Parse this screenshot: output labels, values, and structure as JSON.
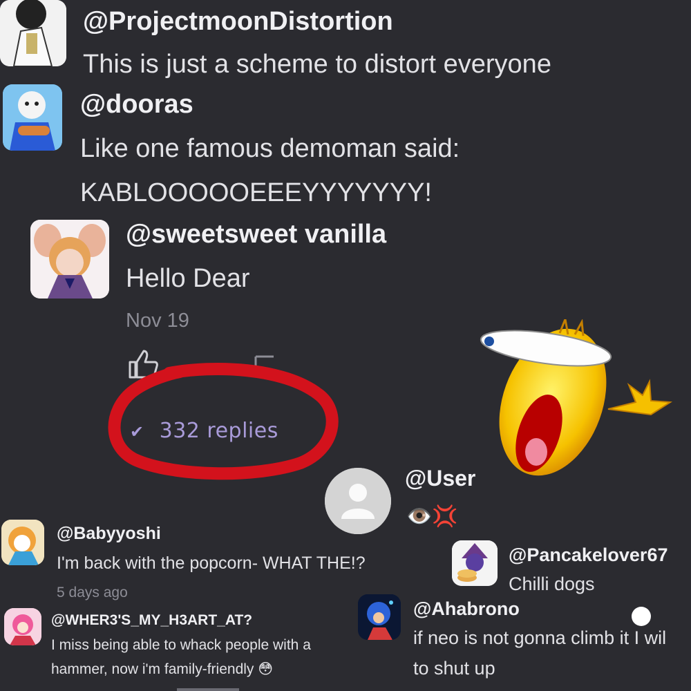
{
  "comments": [
    {
      "handle": "@ProjectmoonDistortion",
      "text": "This is just a scheme to distort everyone"
    },
    {
      "handle": "@dooras",
      "line1": "Like one famous demoman said:",
      "line2": "KABLOOOOOEEEYYYYYYY!"
    },
    {
      "handle": "@sweetsweet vanilla",
      "text": "Hello Dear",
      "date": "Nov 19",
      "replies": "332 replies"
    }
  ],
  "overlay_user": {
    "handle": "@User",
    "reaction": "👁️💢"
  },
  "small_comments": [
    {
      "handle": "@Babyyoshi",
      "text": "I'm back with the popcorn- WHAT THE!?",
      "date": "5 days ago"
    },
    {
      "handle": "@Pancakelover67",
      "text": "Chilli dogs"
    },
    {
      "handle": "@WHER3'S_MY_H3ART_AT?",
      "line1": "I miss being able to whack people with a",
      "line2": "hammer, now i'm family-friendly 😳"
    },
    {
      "handle": "@Ahabrono",
      "line1": "if neo is not gonna climb it I wil",
      "line2": "to shut up"
    }
  ],
  "icons": {
    "like": "thumbs-up-icon",
    "chevron": "chevron-down-icon",
    "sticker": "screaming-face-sticker"
  },
  "colors": {
    "background": "#2b2b30",
    "annotation_red": "#d3121c",
    "replies_text": "#a99bd9"
  }
}
